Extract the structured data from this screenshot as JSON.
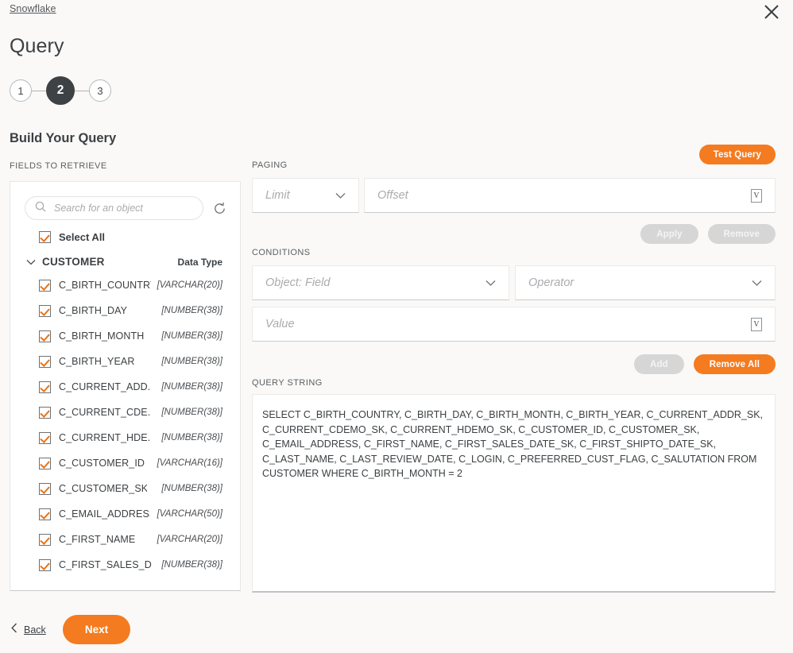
{
  "header": {
    "breadcrumb": "Snowflake",
    "title": "Query",
    "close_icon": "close-icon"
  },
  "stepper": {
    "steps": [
      {
        "label": "1",
        "current": false
      },
      {
        "label": "2",
        "current": true
      },
      {
        "label": "3",
        "current": false
      }
    ]
  },
  "section": {
    "title": "Build Your Query"
  },
  "colors": {
    "accent": "#f47b20",
    "checkmark": "#ec7211",
    "step_active_bg": "#3f4245",
    "page_bg": "#faf9f8",
    "disabled_btn": "#d6d6d6"
  },
  "fields_panel": {
    "label": "FIELDS TO RETRIEVE",
    "search": {
      "placeholder": "Search for an object",
      "value": ""
    },
    "refresh_icon": "refresh-icon",
    "search_icon": "search-icon",
    "select_all": {
      "label": "Select All",
      "checked": true
    },
    "table": {
      "name": "CUSTOMER",
      "expanded": true,
      "data_type_header": "Data Type"
    },
    "fields": [
      {
        "name": "C_BIRTH_COUNTRY",
        "type": "[VARCHAR(20)]",
        "checked": true
      },
      {
        "name": "C_BIRTH_DAY",
        "type": "[NUMBER(38)]",
        "checked": true
      },
      {
        "name": "C_BIRTH_MONTH",
        "type": "[NUMBER(38)]",
        "checked": true
      },
      {
        "name": "C_BIRTH_YEAR",
        "type": "[NUMBER(38)]",
        "checked": true
      },
      {
        "name": "C_CURRENT_ADD...",
        "type": "[NUMBER(38)]",
        "checked": true
      },
      {
        "name": "C_CURRENT_CDE...",
        "type": "[NUMBER(38)]",
        "checked": true
      },
      {
        "name": "C_CURRENT_HDE...",
        "type": "[NUMBER(38)]",
        "checked": true
      },
      {
        "name": "C_CUSTOMER_ID",
        "type": "[VARCHAR(16)]",
        "checked": true
      },
      {
        "name": "C_CUSTOMER_SK",
        "type": "[NUMBER(38)]",
        "checked": true
      },
      {
        "name": "C_EMAIL_ADDRESS",
        "type": "[VARCHAR(50)]",
        "checked": true
      },
      {
        "name": "C_FIRST_NAME",
        "type": "[VARCHAR(20)]",
        "checked": true
      },
      {
        "name": "C_FIRST_SALES_D...",
        "type": "[NUMBER(38)]",
        "checked": true
      }
    ]
  },
  "query_builder": {
    "test_query_label": "Test Query",
    "paging": {
      "label": "PAGING",
      "limit": {
        "placeholder": "Limit",
        "value": ""
      },
      "offset": {
        "placeholder": "Offset",
        "value": "",
        "variable_icon": "V"
      },
      "apply_label": "Apply",
      "remove_label": "Remove"
    },
    "conditions": {
      "label": "CONDITIONS",
      "object_field": {
        "placeholder": "Object: Field",
        "value": ""
      },
      "operator": {
        "placeholder": "Operator",
        "value": ""
      },
      "value": {
        "placeholder": "Value",
        "value": "",
        "variable_icon": "V"
      },
      "add_label": "Add",
      "remove_all_label": "Remove All"
    },
    "query_string": {
      "label": "QUERY STRING",
      "text": "SELECT C_BIRTH_COUNTRY, C_BIRTH_DAY, C_BIRTH_MONTH, C_BIRTH_YEAR, C_CURRENT_ADDR_SK, C_CURRENT_CDEMO_SK, C_CURRENT_HDEMO_SK, C_CUSTOMER_ID, C_CUSTOMER_SK, C_EMAIL_ADDRESS, C_FIRST_NAME, C_FIRST_SALES_DATE_SK, C_FIRST_SHIPTO_DATE_SK, C_LAST_NAME, C_LAST_REVIEW_DATE, C_LOGIN, C_PREFERRED_CUST_FLAG, C_SALUTATION FROM CUSTOMER WHERE C_BIRTH_MONTH = 2"
    }
  },
  "footer": {
    "back_label": "Back",
    "next_label": "Next"
  }
}
